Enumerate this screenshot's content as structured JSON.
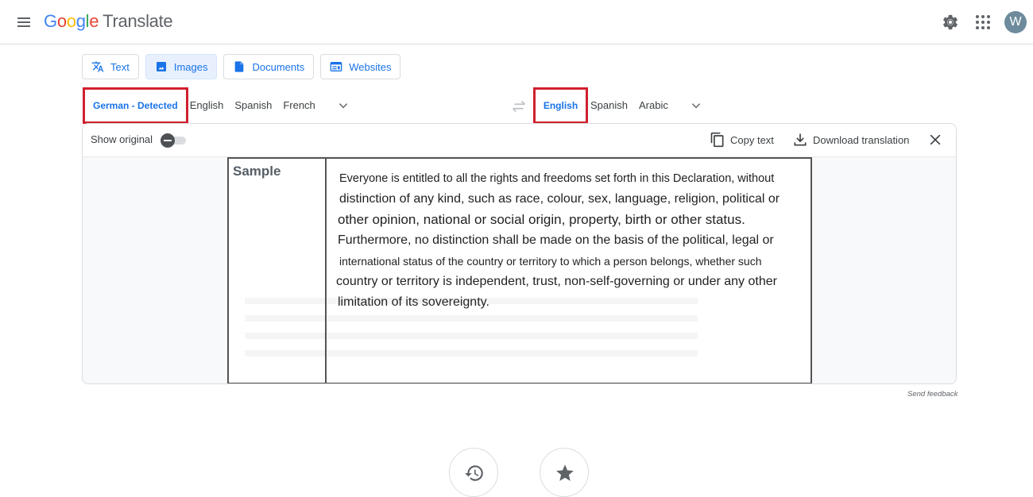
{
  "header": {
    "logo_google": [
      "G",
      "o",
      "o",
      "g",
      "l",
      "e"
    ],
    "logo_product": "Translate",
    "avatar_initial": "W",
    "icons": {
      "menu": "hamburger-menu-icon",
      "settings": "gear-icon",
      "apps": "apps-grid-icon"
    }
  },
  "mode_tabs": [
    {
      "label": "Text",
      "icon": "translate-icon",
      "active": false
    },
    {
      "label": "Images",
      "icon": "image-icon",
      "active": true
    },
    {
      "label": "Documents",
      "icon": "document-icon",
      "active": false
    },
    {
      "label": "Websites",
      "icon": "website-icon",
      "active": false
    }
  ],
  "source_languages": {
    "selected": "German - Detected",
    "options": [
      "English",
      "Spanish",
      "French"
    ]
  },
  "target_languages": {
    "selected": "English",
    "options": [
      "Spanish",
      "Arabic"
    ]
  },
  "panel": {
    "show_original_label": "Show original",
    "show_original_on": false,
    "copy_label": "Copy text",
    "download_label": "Download translation"
  },
  "document": {
    "heading": "Sample",
    "lines": [
      "Everyone is entitled to all the rights and freedoms set forth in this Declaration, without",
      "distinction of any kind, such as race, colour, sex, language, religion, political or",
      "other opinion, national or social origin, property, birth or other status.",
      "Furthermore, no distinction shall be made on the basis of the political, legal or",
      "international status of the country or territory to which a person belongs, whether such",
      "country or territory is independent, trust, non-self-governing or under any other",
      "limitation of its sovereignty."
    ]
  },
  "feedback_label": "Send feedback",
  "bottom_actions": [
    {
      "label": "History",
      "icon": "history-icon"
    },
    {
      "label": "Saved",
      "icon": "star-icon"
    }
  ],
  "colors": {
    "accent": "#1a73e8",
    "highlight_box": "#d0202e",
    "active_tab_bg": "#e8f0fe"
  }
}
